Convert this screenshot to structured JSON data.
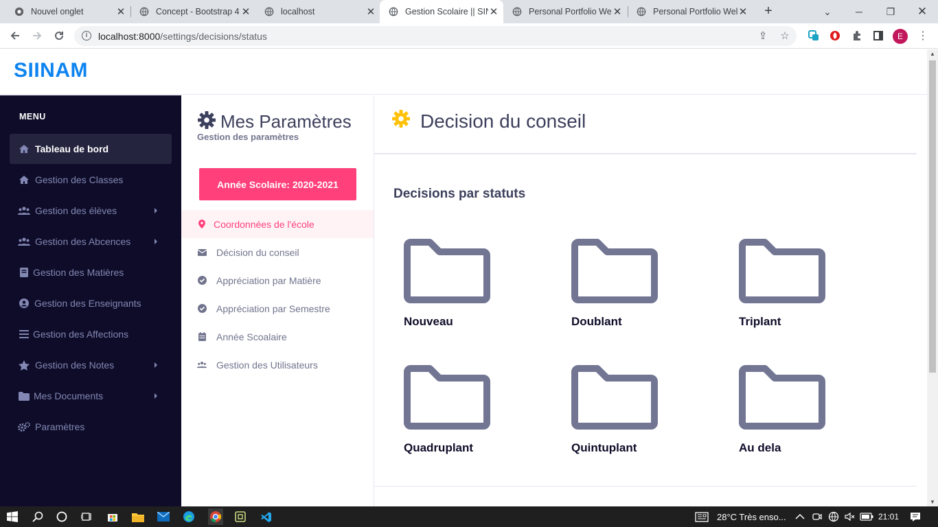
{
  "browser": {
    "tabs": [
      {
        "title": "Nouvel onglet",
        "active": false
      },
      {
        "title": "Concept - Bootstrap 4",
        "active": false
      },
      {
        "title": "localhost",
        "active": false
      },
      {
        "title": "Gestion Scolaire || SIN",
        "active": true
      },
      {
        "title": "Personal Portfolio Wel",
        "active": false
      },
      {
        "title": "Personal Portfolio Wel",
        "active": false
      }
    ],
    "url_host": "localhost:8000",
    "url_path": "/settings/decisions/status",
    "profile_initial": "E"
  },
  "app": {
    "brand": "SIINAM",
    "sidebar": {
      "menu_title": "MENU",
      "items": [
        {
          "label": "Tableau de bord",
          "icon": "home-icon",
          "active": true,
          "has_submenu": false
        },
        {
          "label": "Gestion des Classes",
          "icon": "home-icon",
          "active": false,
          "has_submenu": false
        },
        {
          "label": "Gestion des élèves",
          "icon": "users-icon",
          "active": false,
          "has_submenu": true
        },
        {
          "label": "Gestion des Abcences",
          "icon": "users-icon",
          "active": false,
          "has_submenu": true
        },
        {
          "label": "Gestion des Matières",
          "icon": "book-icon",
          "active": false,
          "has_submenu": false
        },
        {
          "label": "Gestion des Enseignants",
          "icon": "user-circle-icon",
          "active": false,
          "has_submenu": false
        },
        {
          "label": "Gestion des Affections",
          "icon": "bars-icon",
          "active": false,
          "has_submenu": false
        },
        {
          "label": "Gestion des Notes",
          "icon": "star-icon",
          "active": false,
          "has_submenu": true
        },
        {
          "label": "Mes Documents",
          "icon": "folder-icon",
          "active": false,
          "has_submenu": true
        },
        {
          "label": "Paramètres",
          "icon": "cogs-icon",
          "active": false,
          "has_submenu": false
        }
      ]
    },
    "settings": {
      "title": "Mes Paramètres",
      "subtitle": "Gestion des paramètres",
      "year_button": "Année Scolaire: 2020-2021",
      "nav": [
        {
          "label": "Coordonnées de l'école",
          "icon": "map-marker-icon",
          "active": true
        },
        {
          "label": "Décision du conseil",
          "icon": "envelope-icon",
          "active": false
        },
        {
          "label": "Appréciation par Matière",
          "icon": "check-circle-icon",
          "active": false
        },
        {
          "label": "Appréciation par Semestre",
          "icon": "check-circle-icon",
          "active": false
        },
        {
          "label": "Année Scoalaire",
          "icon": "calendar-icon",
          "active": false
        },
        {
          "label": "Gestion des Utilisateurs",
          "icon": "users-icon",
          "active": false
        }
      ]
    },
    "main": {
      "title": "Decision du conseil",
      "section_title": "Decisions par statuts",
      "folders": [
        "Nouveau",
        "Doublant",
        "Triplant",
        "Quadruplant",
        "Quintuplant",
        "Au dela"
      ]
    }
  },
  "taskbar": {
    "weather": "28°C  Très enso...",
    "time": "21:01"
  },
  "colors": {
    "brand": "#0e84f0",
    "sidebar_bg": "#0e0c28",
    "accent_pink": "#ff407b",
    "gear_yellow": "#ffc108",
    "folder_gray": "#727693"
  }
}
